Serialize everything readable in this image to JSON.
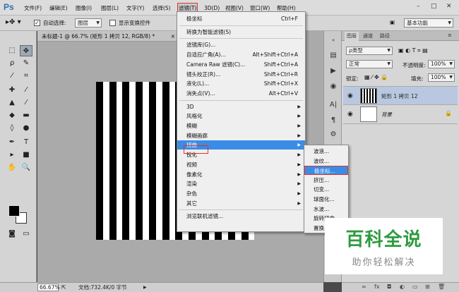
{
  "app": {
    "logo": "Ps"
  },
  "menubar": {
    "items": [
      "文件(F)",
      "编辑(E)",
      "图像(I)",
      "图层(L)",
      "文字(Y)",
      "选择(S)",
      "滤镜(T)",
      "3D(D)",
      "视图(V)",
      "窗口(W)",
      "帮助(H)"
    ],
    "active": "滤镜(T)",
    "window_controls": [
      "–",
      "□",
      "✕"
    ]
  },
  "options_bar": {
    "auto_select_label": "自动选择:",
    "auto_select_value": "图层",
    "show_transform_label": "显示变换控件",
    "workspace": "基本功能"
  },
  "document": {
    "tab_title": "未标题-1 @ 66.7% (矩形 1 拷贝 12, RGB/8) *",
    "close": "×"
  },
  "statusbar": {
    "zoom": "66.67%",
    "doc_info": "文档:732.4K/0 字节"
  },
  "filter_menu": {
    "items": [
      {
        "label": "极坐标",
        "shortcut": "Ctrl+F"
      },
      {
        "sep": true
      },
      {
        "label": "转换为智能滤镜(S)"
      },
      {
        "sep": true
      },
      {
        "label": "滤镜库(G)..."
      },
      {
        "label": "自适应广角(A)...",
        "shortcut": "Alt+Shift+Ctrl+A"
      },
      {
        "label": "Camera Raw 滤镜(C)...",
        "shortcut": "Shift+Ctrl+A"
      },
      {
        "label": "镜头校正(R)...",
        "shortcut": "Shift+Ctrl+R"
      },
      {
        "label": "液化(L)...",
        "shortcut": "Shift+Ctrl+X"
      },
      {
        "label": "消失点(V)...",
        "shortcut": "Alt+Ctrl+V"
      },
      {
        "sep": true
      },
      {
        "label": "3D",
        "submenu": true
      },
      {
        "label": "风格化",
        "submenu": true
      },
      {
        "label": "模糊",
        "submenu": true
      },
      {
        "label": "模糊画廊",
        "submenu": true
      },
      {
        "label": "扭曲",
        "submenu": true,
        "highlighted": true
      },
      {
        "label": "锐化",
        "submenu": true
      },
      {
        "label": "视频",
        "submenu": true
      },
      {
        "label": "像素化",
        "submenu": true
      },
      {
        "label": "渲染",
        "submenu": true
      },
      {
        "label": "杂色",
        "submenu": true
      },
      {
        "label": "其它",
        "submenu": true
      },
      {
        "sep": true
      },
      {
        "label": "浏览联机滤镜..."
      }
    ]
  },
  "distort_submenu": {
    "items": [
      {
        "label": "波浪..."
      },
      {
        "label": "波纹..."
      },
      {
        "label": "极坐标...",
        "highlighted": true
      },
      {
        "label": "挤压..."
      },
      {
        "label": "切变..."
      },
      {
        "label": "球面化..."
      },
      {
        "label": "水波..."
      },
      {
        "label": "旋转扭曲..."
      },
      {
        "label": "置换..."
      }
    ]
  },
  "layers_panel": {
    "tabs": [
      "图层",
      "通道",
      "路径"
    ],
    "filter_kind": "ρ类型",
    "blend_mode": "正常",
    "opacity_label": "不透明度:",
    "opacity_value": "100%",
    "lock_label": "锁定:",
    "fill_label": "填充:",
    "fill_value": "100%",
    "layers": [
      {
        "name": "矩形 1 拷贝 12",
        "selected": true
      },
      {
        "name": "背景",
        "locked": true
      }
    ]
  },
  "watermark": {
    "title": "百科全说",
    "subtitle": "助你轻松解决"
  },
  "colors": {
    "highlight": "#3a8ce6",
    "red_box": "#e0342b",
    "watermark_green": "#2f9b3f"
  }
}
